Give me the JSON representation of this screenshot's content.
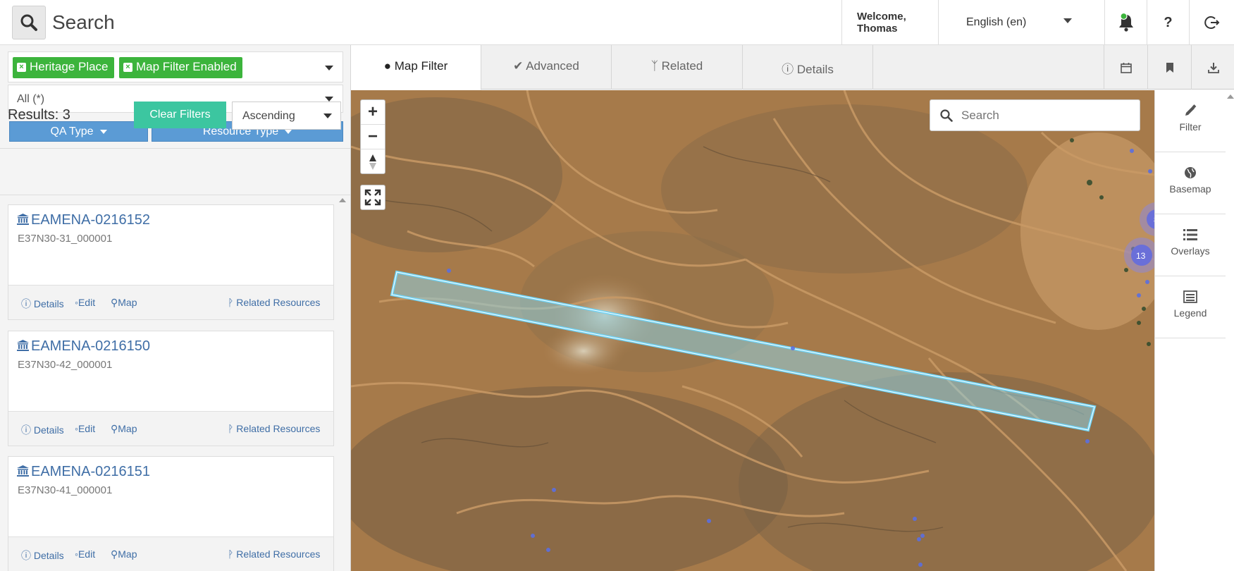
{
  "header": {
    "search_title": "Search",
    "welcome": "Welcome,",
    "user": "Thomas",
    "language": "English (en)",
    "help": "?"
  },
  "filters": {
    "tags": [
      "Heritage Place",
      "Map Filter Enabled"
    ],
    "scope": "All (*)",
    "qa_type": "QA Type",
    "resource_type": "Resource Type"
  },
  "results": {
    "label": "Results: 3",
    "clear_filters": "Clear Filters",
    "sort": "Ascending",
    "items": [
      {
        "title": "EAMENA-0216152",
        "subtitle": "E37N30-31_000001"
      },
      {
        "title": "EAMENA-0216150",
        "subtitle": "E37N30-42_000001"
      },
      {
        "title": "EAMENA-0216151",
        "subtitle": "E37N30-41_000001"
      }
    ],
    "actions": {
      "details": "Details",
      "edit": "Edit",
      "map": "Map",
      "related": "Related Resources"
    }
  },
  "tabs": [
    {
      "label": "Map Filter",
      "icon": "map-marker-icon",
      "active": true
    },
    {
      "label": "Advanced",
      "icon": "check-circle-icon",
      "active": false
    },
    {
      "label": "Related",
      "icon": "branch-icon",
      "active": false
    },
    {
      "label": "Details",
      "icon": "info-icon",
      "active": false
    }
  ],
  "map": {
    "search_placeholder": "Search",
    "clusters": [
      "13",
      "8"
    ],
    "zoom_in": "+",
    "zoom_out": "−"
  },
  "sidebar": {
    "items": [
      {
        "label": "Filter",
        "icon": "pencil-icon"
      },
      {
        "label": "Basemap",
        "icon": "globe-icon"
      },
      {
        "label": "Overlays",
        "icon": "list-icon"
      },
      {
        "label": "Legend",
        "icon": "legend-icon"
      }
    ]
  },
  "colors": {
    "tag_green": "#3cb43c",
    "clear_teal": "#3cc6a0",
    "button_blue": "#5b9bd5",
    "link_blue": "#3f6ea6",
    "map_terrain": "#a97c4c",
    "polygon_outline": "#6fd3f5",
    "cluster_purple": "#6a6fd8"
  }
}
